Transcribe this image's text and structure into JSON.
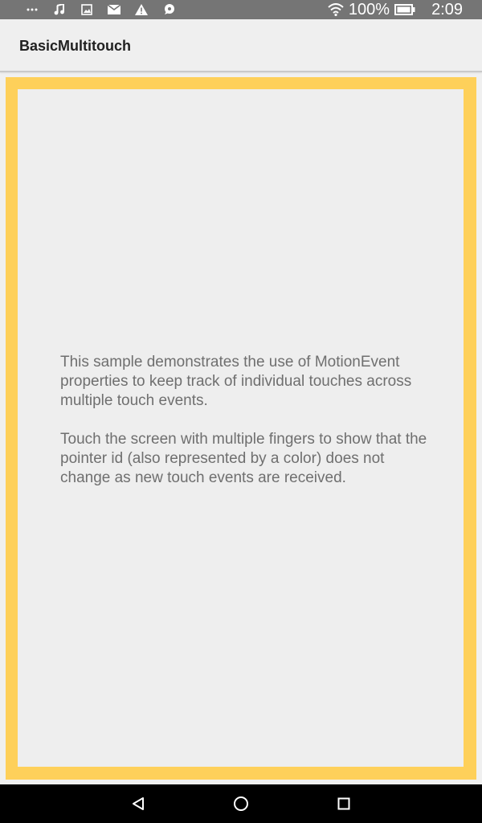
{
  "status_bar": {
    "left_icons": [
      "more-dots-icon",
      "music-note-icon",
      "image-icon",
      "mail-icon",
      "warning-icon",
      "chat-bubble-icon"
    ],
    "right_icons": [
      "wifi-icon",
      "battery-icon"
    ],
    "battery_text": "100%",
    "battery_level": 1.0,
    "time": "2:09"
  },
  "app_bar": {
    "title": "BasicMultitouch"
  },
  "content": {
    "paragraph_1": "This sample demonstrates the use of MotionEvent properties to keep track of individual touches across multiple touch events.",
    "paragraph_2": "Touch the screen with multiple fingers to show that the pointer id (also represented by a color) does not change as new touch events are received."
  },
  "colors": {
    "frame_accent": "#fed05a",
    "touch_background": "#eeeeee",
    "status_bar": "#757575",
    "nav_bar": "#000000"
  },
  "nav_bar": {
    "buttons": [
      "back-icon",
      "home-icon",
      "recents-icon"
    ]
  }
}
